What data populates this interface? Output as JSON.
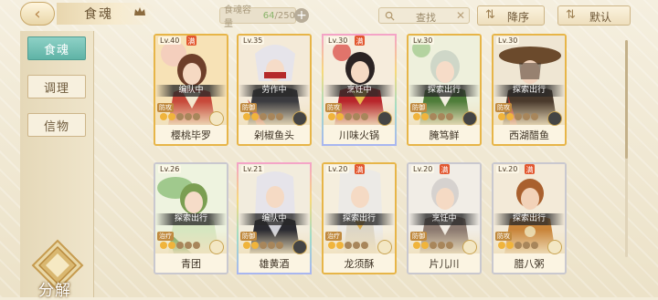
{
  "header": {
    "title": "食魂",
    "capacity_label": "食魂容量",
    "capacity_current": "64",
    "capacity_sep": "/",
    "capacity_max": "250",
    "search_placeholder": "查找",
    "sort_label": "降序",
    "default_label": "默认"
  },
  "sidebar": {
    "tabs": [
      {
        "label": "食魂",
        "active": true
      },
      {
        "label": "调理",
        "active": false
      },
      {
        "label": "信物",
        "active": false
      }
    ],
    "decompose_label": "分解"
  },
  "cards": [
    {
      "level": "Lv.40",
      "status": "编队中",
      "tag": "防攻",
      "name": "樱桃毕罗"
    },
    {
      "level": "Lv.35",
      "status": "劳作中",
      "tag": "防御",
      "name": "剁椒鱼头"
    },
    {
      "level": "Lv.30",
      "status": "烹饪中",
      "tag": "防攻",
      "name": "川味火锅"
    },
    {
      "level": "Lv.30",
      "status": "探索出行",
      "tag": "防御",
      "name": "腌笃鲜"
    },
    {
      "level": "Lv.30",
      "status": "探索出行",
      "tag": "防攻",
      "name": "西湖醋鱼"
    },
    {
      "level": "Lv.26",
      "status": "探索出行",
      "tag": "治疗",
      "name": "青团"
    },
    {
      "level": "Lv.21",
      "status": "编队中",
      "tag": "防御",
      "name": "雄黄酒"
    },
    {
      "level": "Lv.20",
      "status": "探索出行",
      "tag": "治疗",
      "name": "龙须酥"
    },
    {
      "level": "Lv.20",
      "status": "烹饪中",
      "tag": "防御",
      "name": "片儿川"
    },
    {
      "level": "Lv.20",
      "status": "探索出行",
      "tag": "防攻",
      "name": "腊八粥"
    }
  ],
  "colors": {
    "accent_tab": "#5fb3a6",
    "card_gold": "#e7b548",
    "status_bar": "#3a3a3a"
  }
}
